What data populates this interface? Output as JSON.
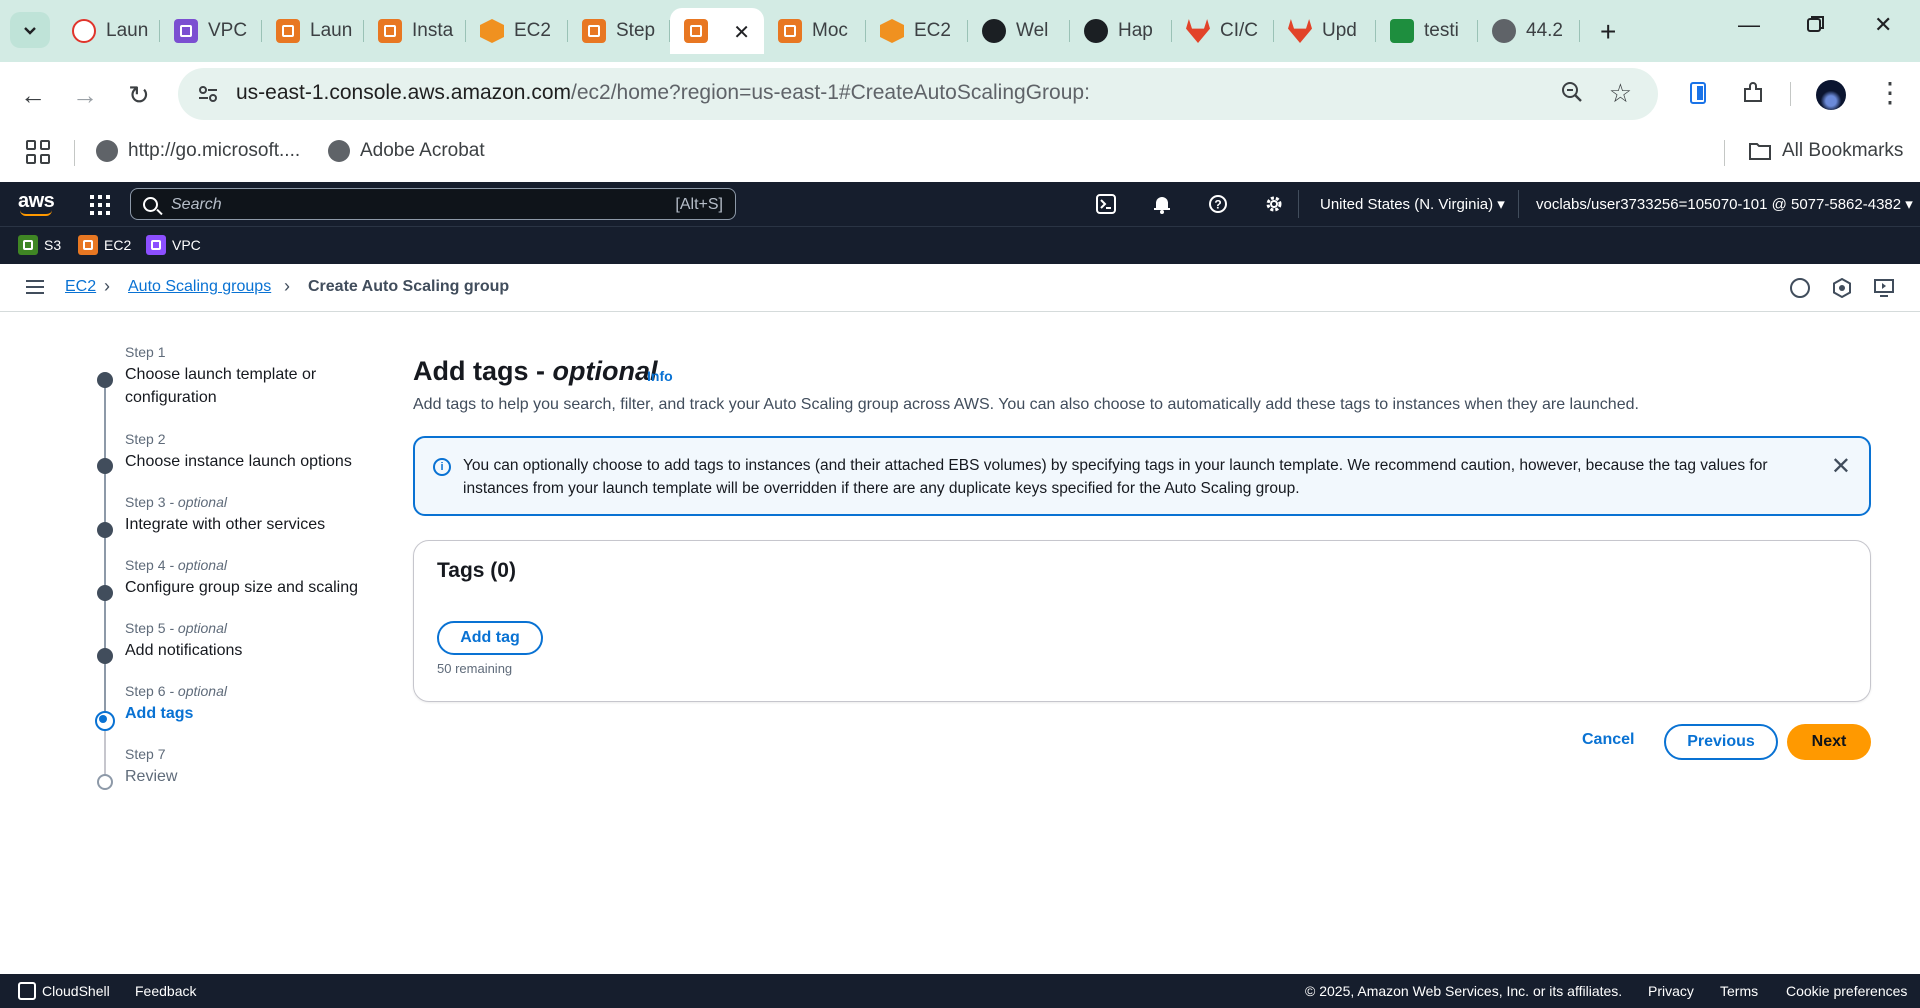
{
  "browser": {
    "tabs": [
      {
        "title": "Laun",
        "icon": "red-gear-icon"
      },
      {
        "title": "VPC",
        "icon": "vpc-icon"
      },
      {
        "title": "Laun",
        "icon": "ec2-icon"
      },
      {
        "title": "Insta",
        "icon": "ec2-icon"
      },
      {
        "title": "EC2",
        "icon": "cube-icon"
      },
      {
        "title": "Step",
        "icon": "ec2-icon"
      },
      {
        "title": "",
        "icon": "ec2-icon",
        "active": true
      },
      {
        "title": "Moc",
        "icon": "ec2-icon"
      },
      {
        "title": "EC2",
        "icon": "cube-icon"
      },
      {
        "title": "Wel",
        "icon": "github-icon"
      },
      {
        "title": "Hap",
        "icon": "openai-icon"
      },
      {
        "title": "CI/C",
        "icon": "gitlab-icon"
      },
      {
        "title": "Upd",
        "icon": "gitlab-icon"
      },
      {
        "title": "testi",
        "icon": "sheets-icon"
      },
      {
        "title": "44.2",
        "icon": "globe-icon"
      }
    ],
    "url_host": "us-east-1.console.aws.amazon.com",
    "url_path": "/ec2/home?region=us-east-1#CreateAutoScalingGroup:",
    "bookmarks": [
      {
        "label": "http://go.microsoft...."
      },
      {
        "label": "Adobe Acrobat"
      }
    ],
    "all_bookmarks": "All Bookmarks"
  },
  "aws_header": {
    "logo": "aws",
    "search_placeholder": "Search",
    "search_shortcut": "[Alt+S]",
    "region": "United States (N. Virginia) ▾",
    "account": "voclabs/user3733256=105070-101 @ 5077-5862-4382 ▾",
    "services": [
      {
        "label": "S3",
        "color": "#3f8624"
      },
      {
        "label": "EC2",
        "color": "#e87722"
      },
      {
        "label": "VPC",
        "color": "#8c4fff"
      }
    ]
  },
  "breadcrumb": {
    "items": [
      "EC2",
      "Auto Scaling groups"
    ],
    "current": "Create Auto Scaling group"
  },
  "steps": [
    {
      "num": "Step 1",
      "optional": "",
      "title_lines": [
        "Choose launch template or",
        "configuration"
      ],
      "state": "done"
    },
    {
      "num": "Step 2",
      "optional": "",
      "title_lines": [
        "Choose instance launch options"
      ],
      "state": "done"
    },
    {
      "num": "Step 3",
      "optional": " - optional",
      "title_lines": [
        "Integrate with other services"
      ],
      "state": "done"
    },
    {
      "num": "Step 4",
      "optional": " - optional",
      "title_lines": [
        "Configure group size and scaling"
      ],
      "state": "done"
    },
    {
      "num": "Step 5",
      "optional": " - optional",
      "title_lines": [
        "Add notifications"
      ],
      "state": "done"
    },
    {
      "num": "Step 6",
      "optional": " - optional",
      "title_lines": [
        "Add tags"
      ],
      "state": "current"
    },
    {
      "num": "Step 7",
      "optional": "",
      "title_lines": [
        "Review"
      ],
      "state": "future"
    }
  ],
  "main": {
    "title": "Add tags - ",
    "title_optional": "optional",
    "info": "Info",
    "description": "Add tags to help you search, filter, and track your Auto Scaling group across AWS. You can also choose to automatically add these tags to instances when they are launched.",
    "alert": "You can optionally choose to add tags to instances (and their attached EBS volumes) by specifying tags in your launch template. We recommend caution, however, because the tag values for instances from your launch template will be overridden if there are any duplicate keys specified for the Auto Scaling group.",
    "tags_title": "Tags (0)",
    "add_tag": "Add tag",
    "remaining": "50 remaining"
  },
  "actions": {
    "cancel": "Cancel",
    "previous": "Previous",
    "next": "Next"
  },
  "footer": {
    "cloudshell": "CloudShell",
    "feedback": "Feedback",
    "copyright": "© 2025, Amazon Web Services, Inc. or its affiliates.",
    "privacy": "Privacy",
    "terms": "Terms",
    "cookie": "Cookie preferences"
  },
  "colors": {
    "accent": "#0972d3",
    "primary_button": "#ff9900",
    "aws_nav": "#161e2d"
  }
}
